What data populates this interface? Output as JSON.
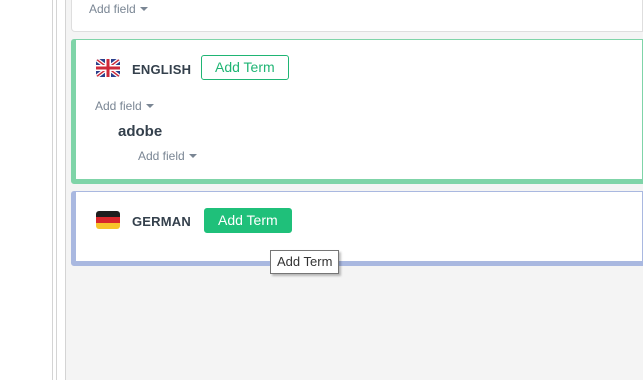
{
  "top_card": {
    "add_field_label": "Add field"
  },
  "english": {
    "language": "ENGLISH",
    "add_term_label": "Add Term",
    "add_field_label": "Add field",
    "term": "adobe",
    "term_add_field_label": "Add field",
    "flag_icon": "uk-flag-icon",
    "accent_color": "#7fd4a8"
  },
  "german": {
    "language": "GERMAN",
    "add_term_label": "Add Term",
    "flag_icon": "germany-flag-icon",
    "accent_color": "#a9b8e0"
  },
  "tooltip": {
    "text": "Add Term"
  },
  "colors": {
    "button_green": "#1fc07a",
    "background": "#f4f4f4"
  }
}
